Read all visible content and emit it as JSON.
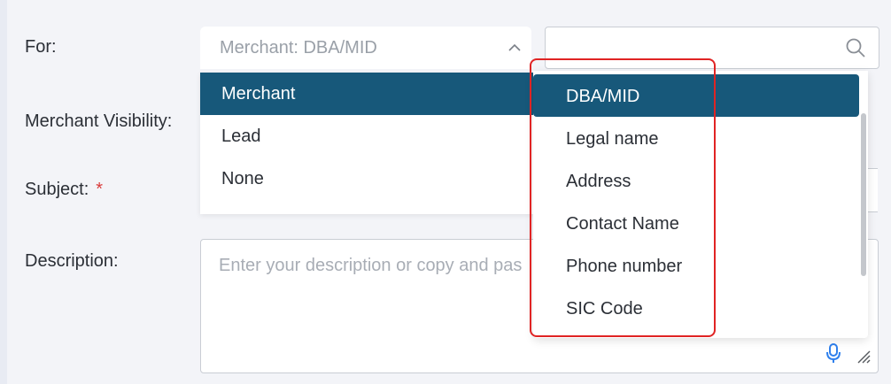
{
  "form": {
    "for_label": "For:",
    "merchant_visibility_label": "Merchant Visibility:",
    "subject_label": "Subject:",
    "required_marker": "*",
    "description_label": "Description:",
    "for_select_value": "Merchant: DBA/MID",
    "search_value": "",
    "description_placeholder": "Enter your description or copy and pas"
  },
  "entity_menu": {
    "items": [
      "Merchant",
      "Lead",
      "None"
    ],
    "selected": "Merchant"
  },
  "field_menu": {
    "items": [
      "DBA/MID",
      "Legal name",
      "Address",
      "Contact Name",
      "Phone number",
      "SIC Code"
    ],
    "selected": "DBA/MID"
  },
  "icons": {
    "select_chevron": "chevron-up-icon",
    "search": "search-icon",
    "mic": "microphone-icon",
    "resize": "resize-handle-icon"
  },
  "colors": {
    "selected_bg": "#17587a",
    "required": "#d93b3b",
    "highlight": "#e02424",
    "mic": "#2f80ed"
  }
}
